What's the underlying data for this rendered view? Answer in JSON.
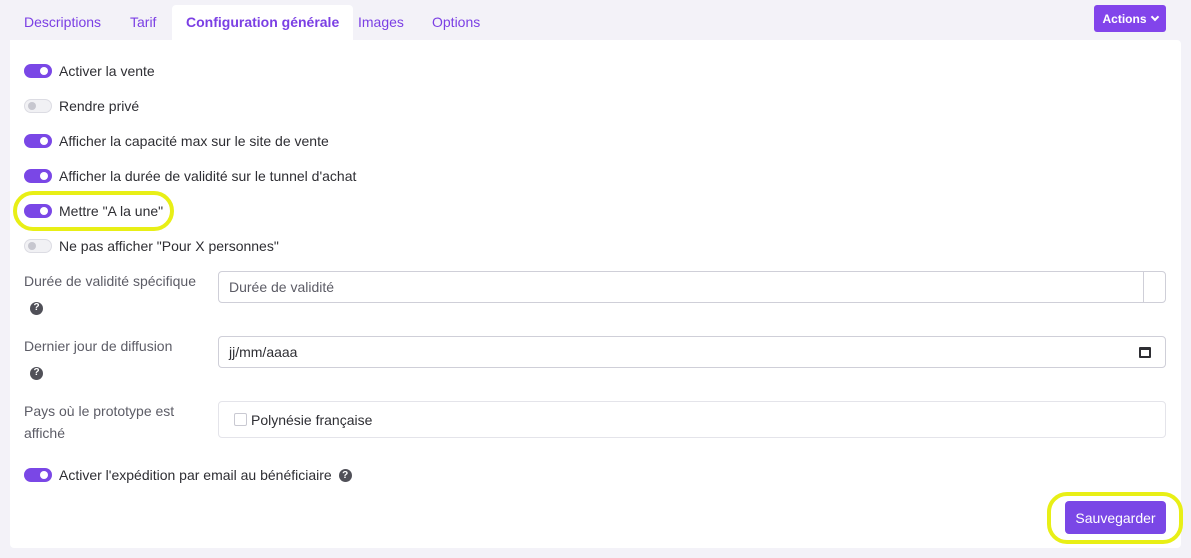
{
  "tabs": [
    {
      "label": "Descriptions"
    },
    {
      "label": "Tarif"
    },
    {
      "label": "Configuration générale"
    },
    {
      "label": "Images"
    },
    {
      "label": "Options"
    }
  ],
  "active_tab": "Configuration générale",
  "actions_button": {
    "label": "Actions"
  },
  "toggles": [
    {
      "label": "Activer la vente",
      "enabled": true
    },
    {
      "label": "Rendre privé",
      "enabled": false
    },
    {
      "label": "Afficher la capacité max sur le site de vente",
      "enabled": true
    },
    {
      "label": "Afficher la durée de validité sur le tunnel d'achat",
      "enabled": true
    },
    {
      "label": "Mettre \"A la une\"",
      "enabled": true
    },
    {
      "label": "Ne pas afficher \"Pour X personnes\"",
      "enabled": false
    }
  ],
  "fields": {
    "validity": {
      "label": "Durée de validité spécifique",
      "placeholder": "Durée de validité"
    },
    "last_day": {
      "label": "Dernier jour de diffusion",
      "value": "jj/mm/aaaa"
    },
    "countries": {
      "label": "Pays où le prototype est affiché",
      "option": "Polynésie française",
      "checked": false
    }
  },
  "email_toggle": {
    "label": "Activer l'expédition par email au bénéficiaire",
    "enabled": true
  },
  "save_button": {
    "label": "Sauvegarder"
  },
  "colors": {
    "accent": "#7a47e6",
    "highlight": "#e8ef16"
  }
}
